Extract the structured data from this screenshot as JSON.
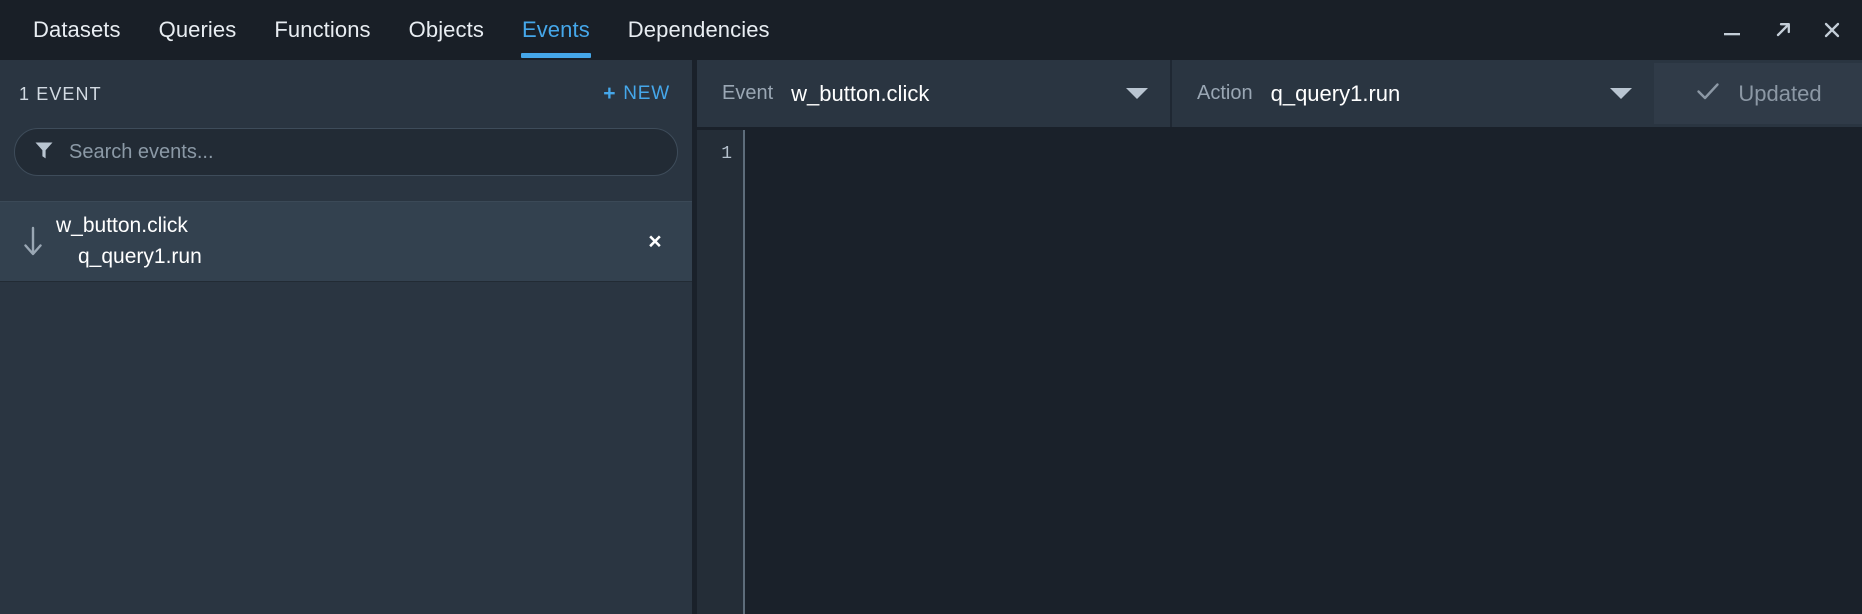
{
  "topbar": {
    "tabs": [
      {
        "label": "Datasets",
        "active": false
      },
      {
        "label": "Queries",
        "active": false
      },
      {
        "label": "Functions",
        "active": false
      },
      {
        "label": "Objects",
        "active": false
      },
      {
        "label": "Events",
        "active": true
      },
      {
        "label": "Dependencies",
        "active": false
      }
    ],
    "window_controls": [
      {
        "name": "minimize-icon",
        "glyph": "minimize"
      },
      {
        "name": "expand-icon",
        "glyph": "expand"
      },
      {
        "name": "close-icon",
        "glyph": "close"
      }
    ],
    "accent_color": "#45a7ea",
    "background": "#191f27"
  },
  "left_panel": {
    "count_label": "1 EVENT",
    "new_button": {
      "plus": "+",
      "label": "NEW"
    },
    "search": {
      "placeholder": "Search events...",
      "value": "",
      "icon": "filter-funnel-icon"
    },
    "events": [
      {
        "icon": "arrow-down-icon",
        "trigger": "w_button.click",
        "action": "q_query1.run",
        "close": "×",
        "selected": true
      }
    ],
    "background": "#2a3541",
    "row_selected_background": "#33414f"
  },
  "right_panel": {
    "event_dropdown": {
      "label": "Event",
      "value": "w_button.click",
      "caret": "chevron-down-icon"
    },
    "action_dropdown": {
      "label": "Action",
      "value": "q_query1.run",
      "caret": "chevron-down-icon"
    },
    "update_button": {
      "label": "Updated",
      "icon": "check-icon",
      "disabled": true
    },
    "editor": {
      "line_numbers": [
        "1"
      ],
      "lines": [
        ""
      ],
      "background": "#1a212a"
    }
  }
}
